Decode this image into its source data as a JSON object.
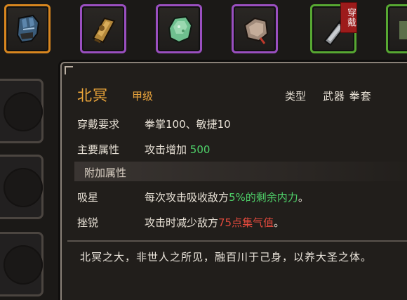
{
  "inventory": {
    "slots": [
      {
        "icon": "gauntlet-icon",
        "rarity": "orange"
      },
      {
        "icon": "bracer-icon",
        "rarity": "purple"
      },
      {
        "icon": "jade-stone-icon",
        "rarity": "purple"
      },
      {
        "icon": "pouch-icon",
        "rarity": "purple"
      },
      {
        "icon": "cleaver-icon",
        "rarity": "green",
        "badge": "穿戴"
      },
      {
        "icon": "unknown-item-icon",
        "rarity": "green"
      }
    ]
  },
  "tooltip": {
    "name": "北冥",
    "grade": "甲级",
    "type_label": "类型",
    "type_value": "武器 拳套",
    "requirement_label": "穿戴要求",
    "requirement_value": "拳掌100、敏捷10",
    "main_attr_label": "主要属性",
    "main_attr_text": "攻击增加",
    "main_attr_value": "500",
    "extra_attr_title": "附加属性",
    "effects": [
      {
        "name": "吸星",
        "pre": "每次攻击吸收敌方",
        "highlight": "5%的剩余内力",
        "post": "。",
        "color": "green"
      },
      {
        "name": "挫锐",
        "pre": "攻击时减少敌方",
        "highlight": "75点集气值",
        "post": "。",
        "color": "red"
      }
    ],
    "description": "北冥之大，非世人之所见，融百川于己身，以养大圣之体。"
  },
  "colors": {
    "name": "#f0a83a",
    "green_value": "#4fd26a",
    "red_value": "#e34a3d",
    "rarity_orange": "#d8861f",
    "rarity_purple": "#9a4fc0",
    "rarity_green": "#57a832"
  }
}
